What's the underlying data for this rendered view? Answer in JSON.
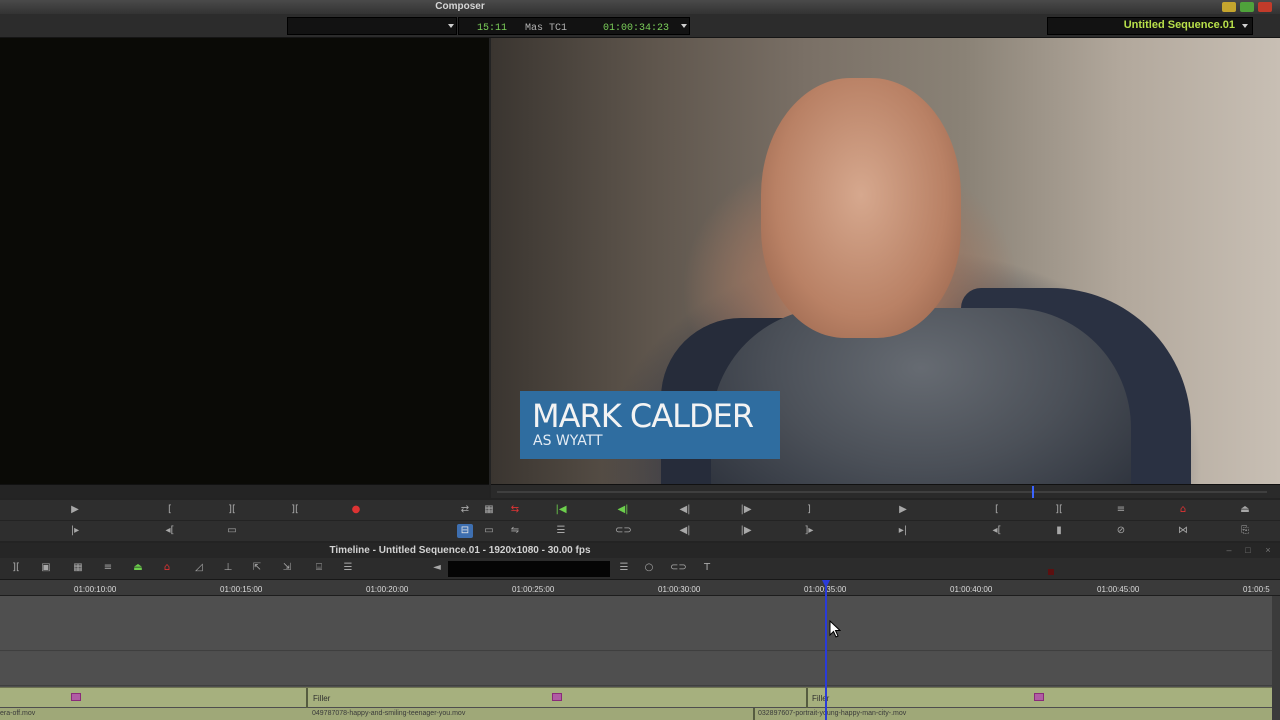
{
  "composer": {
    "title": "Composer",
    "source_menu_label": "",
    "timecode_duration": "15:11",
    "timecode_track": "Mas TC1",
    "timecode_record": "01:00:34:23",
    "sequence_name": "Untitled Sequence.01"
  },
  "record_monitor": {
    "lower_third_name": "MARK CALDER",
    "lower_third_role": "AS WYATT",
    "lower_third_color": "#2f6da0"
  },
  "controls": {
    "row1_icons": [
      "play-icon",
      "mark-in-icon",
      "mark-out-icon",
      "mark-clip-icon",
      "record-icon",
      "sync-icon",
      "grid-icon",
      "trim-icon",
      "mark-in-green-icon",
      "match-frame-icon",
      "step-back-icon",
      "step-forward-icon",
      "mark-out-icon",
      "play-icon",
      "mark-in-icon",
      "mark-out-icon",
      "lift-icon",
      "extract-icon",
      "overwrite-icon"
    ],
    "row2_icons": [
      "play-loop-icon",
      "go-to-in-icon",
      "clip-icon",
      "source-record-icon",
      "toggle-icon",
      "swap-icon",
      "list-icon",
      "link-icon",
      "step-back-10-icon",
      "step-forward-10-icon",
      "go-to-out-icon",
      "go-to-next-icon",
      "go-to-in-icon",
      "add-edit-icon",
      "no-edit-icon",
      "match-icon",
      "copy-icon"
    ]
  },
  "timeline": {
    "title": "Timeline - Untitled Sequence.01 - 1920x1080 - 30.00 fps",
    "ruler_ticks": [
      "01:00:10:00",
      "01:00:15:00",
      "01:00:20:00",
      "01:00:25:00",
      "01:00:30:00",
      "01:00:35:00",
      "01:00:40:00",
      "01:00:45:00",
      "01:00:5"
    ],
    "filler_1": "Filler",
    "filler_2": "Filler",
    "clip_a": "era-off.mov",
    "clip_b": "049787078-happy-and-smiling-teenager-you.mov",
    "clip_c": "032897607-portrait-young-happy-man-city-.mov",
    "track_color": "#a6b07e",
    "playhead_color": "#2a3bd8"
  }
}
